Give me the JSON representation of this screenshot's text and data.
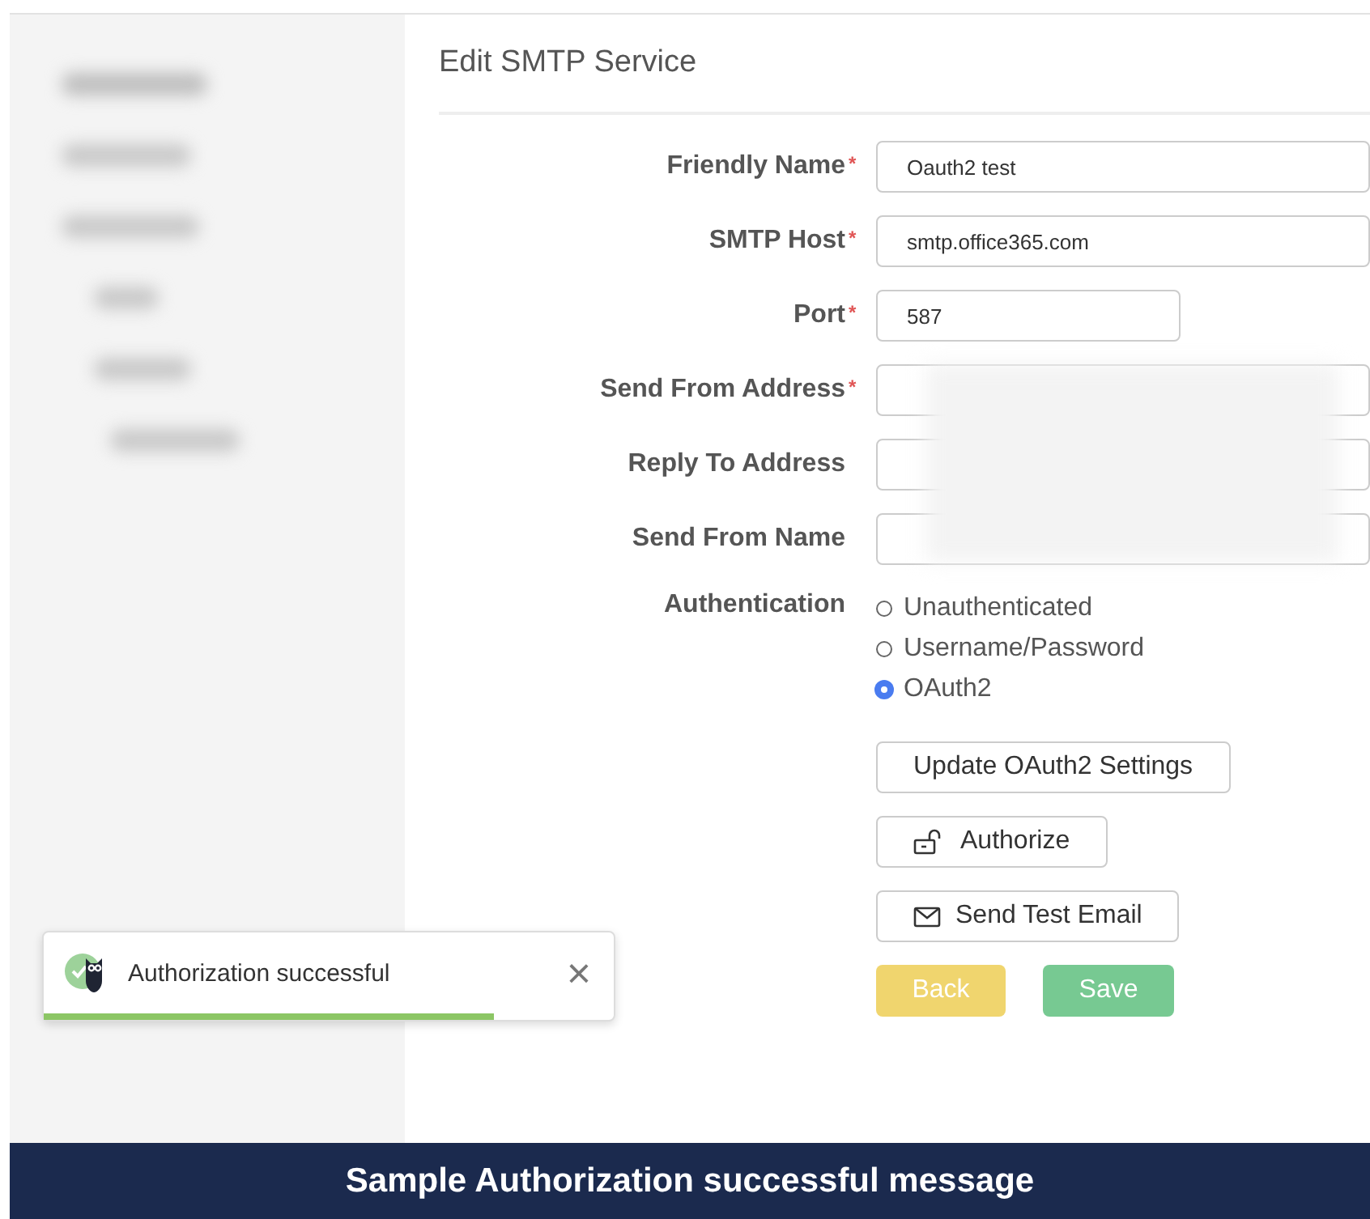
{
  "page_title": "Edit SMTP Service",
  "fields": [
    {
      "label": "Friendly Name",
      "required_mark": "*",
      "value": "Oauth2 test",
      "kind": "text"
    },
    {
      "label": "SMTP Host",
      "required_mark": "*",
      "value": "smtp.office365.com",
      "kind": "text"
    },
    {
      "label": "Port",
      "required_mark": "*",
      "value": "587",
      "kind": "number"
    },
    {
      "label": "Send From Address",
      "required_mark": "*",
      "kind": "text"
    },
    {
      "label": "Reply To Address",
      "kind": "text"
    },
    {
      "label": "Send From Name",
      "kind": "text"
    }
  ],
  "authentication": {
    "label": "Authentication",
    "options": [
      {
        "label": "Unauthenticated",
        "selected": false
      },
      {
        "label": "Username/Password",
        "selected": false
      },
      {
        "label": "OAuth2",
        "selected": true
      }
    ]
  },
  "actions": [
    {
      "label": "Update OAuth2 Settings",
      "kind": "outline"
    },
    {
      "label": "Authorize",
      "kind": "lock"
    },
    {
      "label": "Send Test Email",
      "kind": "mail"
    }
  ],
  "form_buttons": [
    {
      "label": "Back",
      "kind": "warning"
    },
    {
      "label": "Save",
      "kind": "success"
    }
  ],
  "toast": {
    "message": "Authorization successful",
    "close": "×",
    "level": 0.79
  },
  "caption": "Sample Authorization successful message"
}
